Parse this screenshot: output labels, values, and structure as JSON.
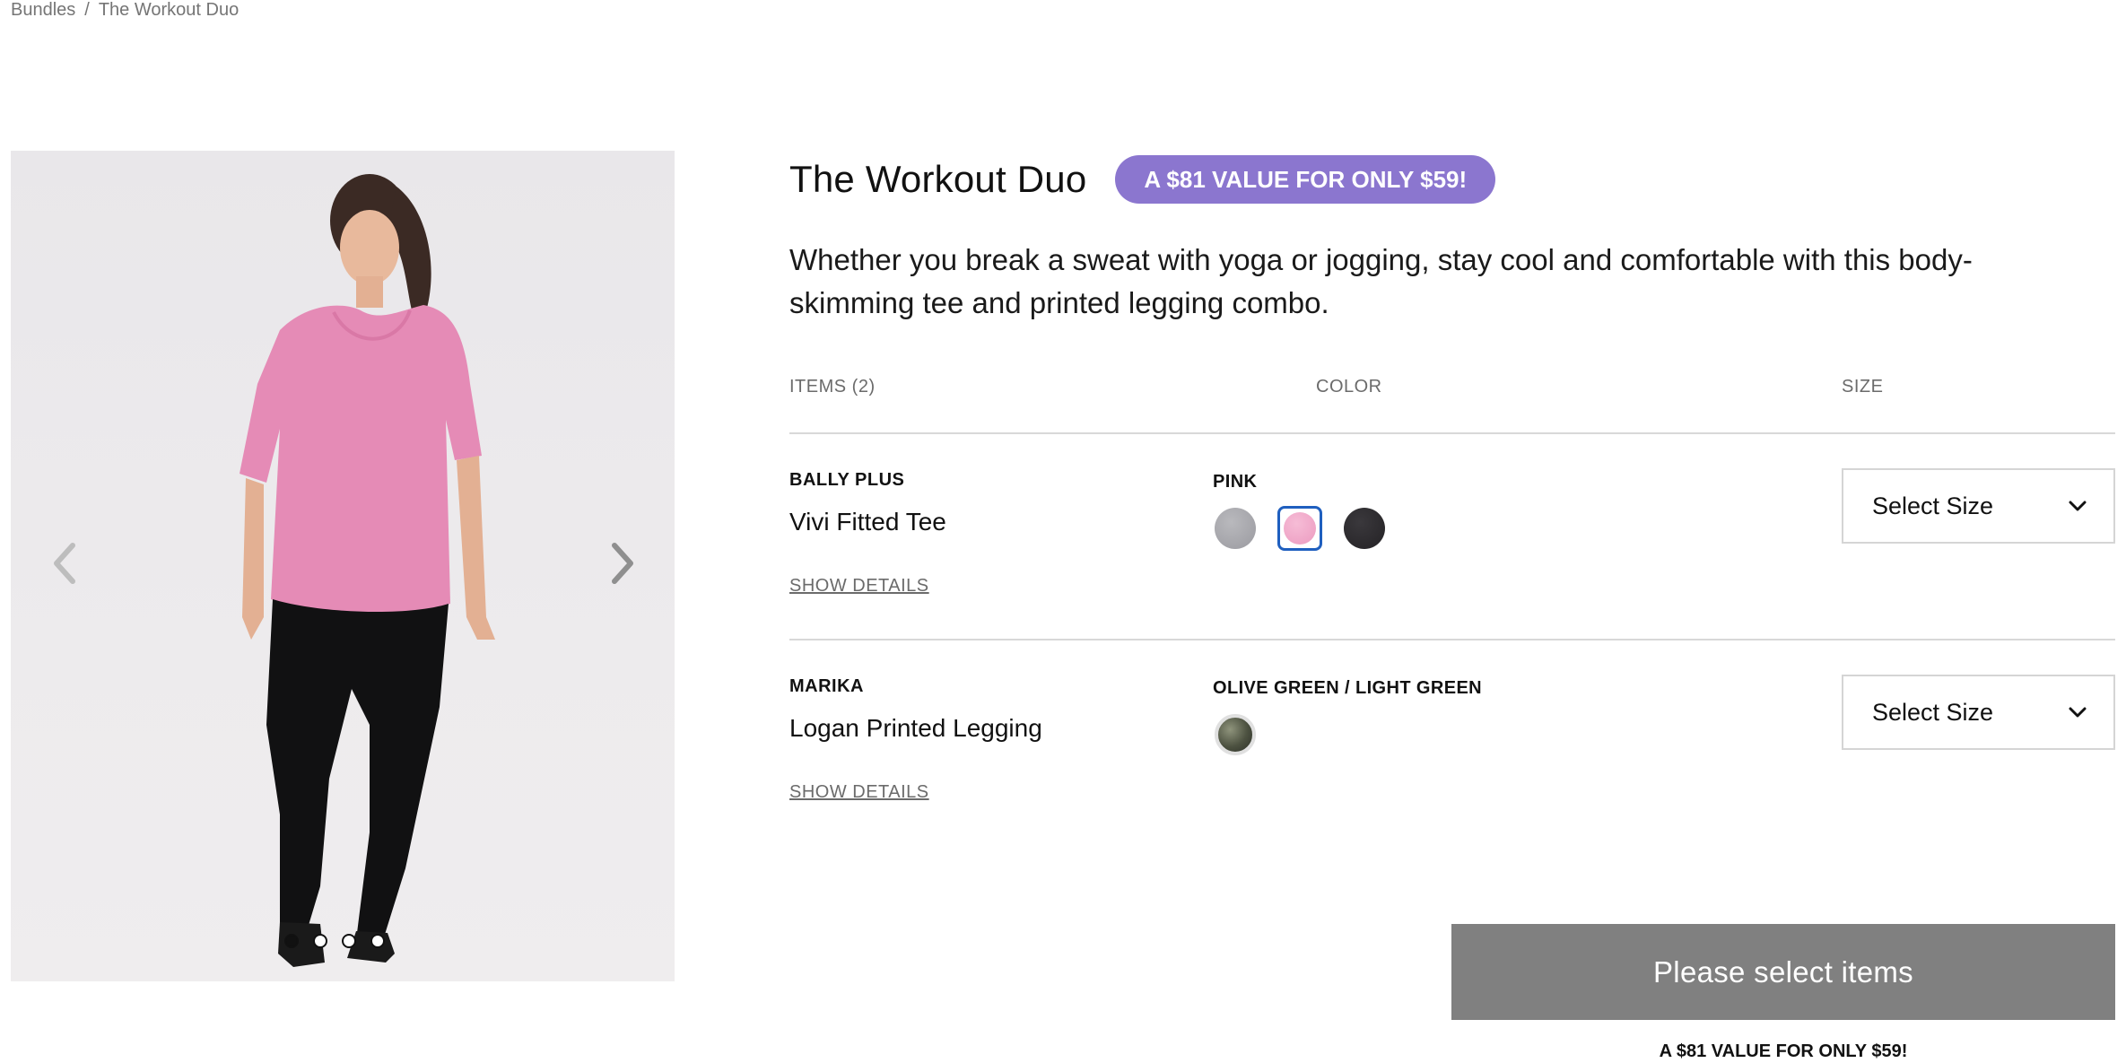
{
  "breadcrumb": {
    "items": [
      "Bundles",
      "The Workout Duo"
    ],
    "separator": "/"
  },
  "gallery": {
    "slide_count": 4,
    "active_slide": 1
  },
  "product": {
    "title": "The Workout Duo",
    "promo": "A $81 VALUE FOR ONLY $59!",
    "description": "Whether you break a sweat with yoga or jogging, stay cool and comfortable with this body-skimming tee and printed legging combo."
  },
  "table": {
    "headers": {
      "items": "ITEMS (2)",
      "color": "COLOR",
      "size": "SIZE"
    },
    "rows": [
      {
        "brand": "BALLY PLUS",
        "name": "Vivi Fitted Tee",
        "details": "SHOW DETAILS",
        "color_name": "PINK",
        "swatches": [
          {
            "name": "heather-grey",
            "color": "#a3a3a8",
            "selected": false
          },
          {
            "name": "pink",
            "color": "#f0a7c7",
            "selected": true
          },
          {
            "name": "charcoal",
            "color": "#2c2a2e",
            "selected": false
          }
        ],
        "size_label": "Select Size"
      },
      {
        "brand": "MARIKA",
        "name": "Logan Printed Legging",
        "details": "SHOW DETAILS",
        "color_name": "OLIVE GREEN / LIGHT GREEN",
        "swatches": [
          {
            "name": "olive-camo",
            "color": "#5d6350",
            "selected": false
          }
        ],
        "size_label": "Select Size"
      }
    ]
  },
  "cta": {
    "label": "Please select items",
    "note": "A $81 VALUE FOR ONLY $59!"
  }
}
